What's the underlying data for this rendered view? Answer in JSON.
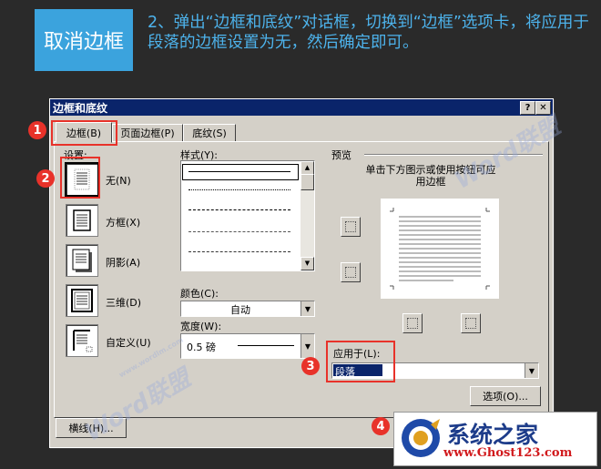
{
  "header": {
    "tag": "取消边框",
    "instruction": "2、弹出“边框和底纹”对话框，切换到“边框”选项卡，将应用于段落的边框设置为无，然后确定即可。"
  },
  "dialog": {
    "title": "边框和底纹",
    "help_btn": "?",
    "close_btn": "✕",
    "tabs": [
      {
        "label": "边框(B)",
        "active": true
      },
      {
        "label": "页面边框(P)",
        "active": false
      },
      {
        "label": "底纹(S)",
        "active": false
      }
    ],
    "settings_label": "设置:",
    "settings": [
      {
        "label": "无(N)",
        "selected": true
      },
      {
        "label": "方框(X)",
        "selected": false
      },
      {
        "label": "阴影(A)",
        "selected": false
      },
      {
        "label": "三维(D)",
        "selected": false
      },
      {
        "label": "自定义(U)",
        "selected": false
      }
    ],
    "style_label": "样式(Y):",
    "color_label": "颜色(C):",
    "color_value": "自动",
    "width_label": "宽度(W):",
    "width_value": "0.5 磅",
    "preview_label": "预览",
    "preview_hint": "单击下方图示或使用按钮可应用边框",
    "apply_label": "应用于(L):",
    "apply_value": "段落",
    "options_btn": "选项(O)...",
    "hline_btn": "横线(H)..."
  },
  "callouts": [
    "1",
    "2",
    "3",
    "4"
  ],
  "logo": {
    "name": "系统之家",
    "url": "www.Ghost123.com"
  },
  "watermark": {
    "text": "Word联盟",
    "site": "www.wordlm.com"
  },
  "colors": {
    "accent": "#3ba3dd",
    "title_bar": "#0a246a",
    "callout": "#e8322a",
    "dialog_bg": "#d4d0c8"
  }
}
